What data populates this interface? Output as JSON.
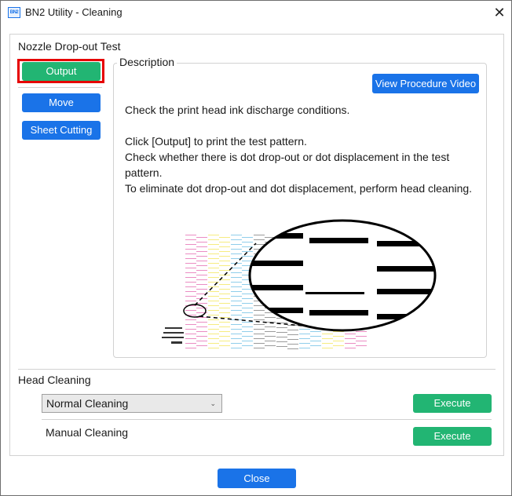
{
  "window": {
    "title": "BN2 Utility - Cleaning",
    "app_icon_text": "BN2",
    "close_glyph": "✕"
  },
  "nozzle_test": {
    "section_title": "Nozzle Drop-out Test",
    "output_label": "Output",
    "move_label": "Move",
    "sheet_cutting_label": "Sheet Cutting",
    "description": {
      "legend": "Description",
      "video_button_label": "View Procedure Video",
      "line1": "Check the print head ink discharge conditions.",
      "line2": "Click [Output] to print the test pattern.",
      "line3": "Check whether there is dot drop-out or dot displacement in the test pattern.",
      "line4": "To eliminate dot drop-out and dot displacement, perform head cleaning."
    }
  },
  "head_cleaning": {
    "section_title": "Head Cleaning",
    "cleaning_type_selected": "Normal Cleaning",
    "execute_label": "Execute",
    "manual_cleaning_label": "Manual Cleaning",
    "manual_execute_label": "Execute"
  },
  "footer": {
    "close_label": "Close"
  },
  "colors": {
    "green": "#22b573",
    "blue": "#1a73e8",
    "highlight_red": "#e60000",
    "pattern_magenta": "#e879b9",
    "pattern_yellow": "#f5e96a",
    "pattern_cyan": "#7cc6e8",
    "pattern_black": "#8a8a8a"
  }
}
